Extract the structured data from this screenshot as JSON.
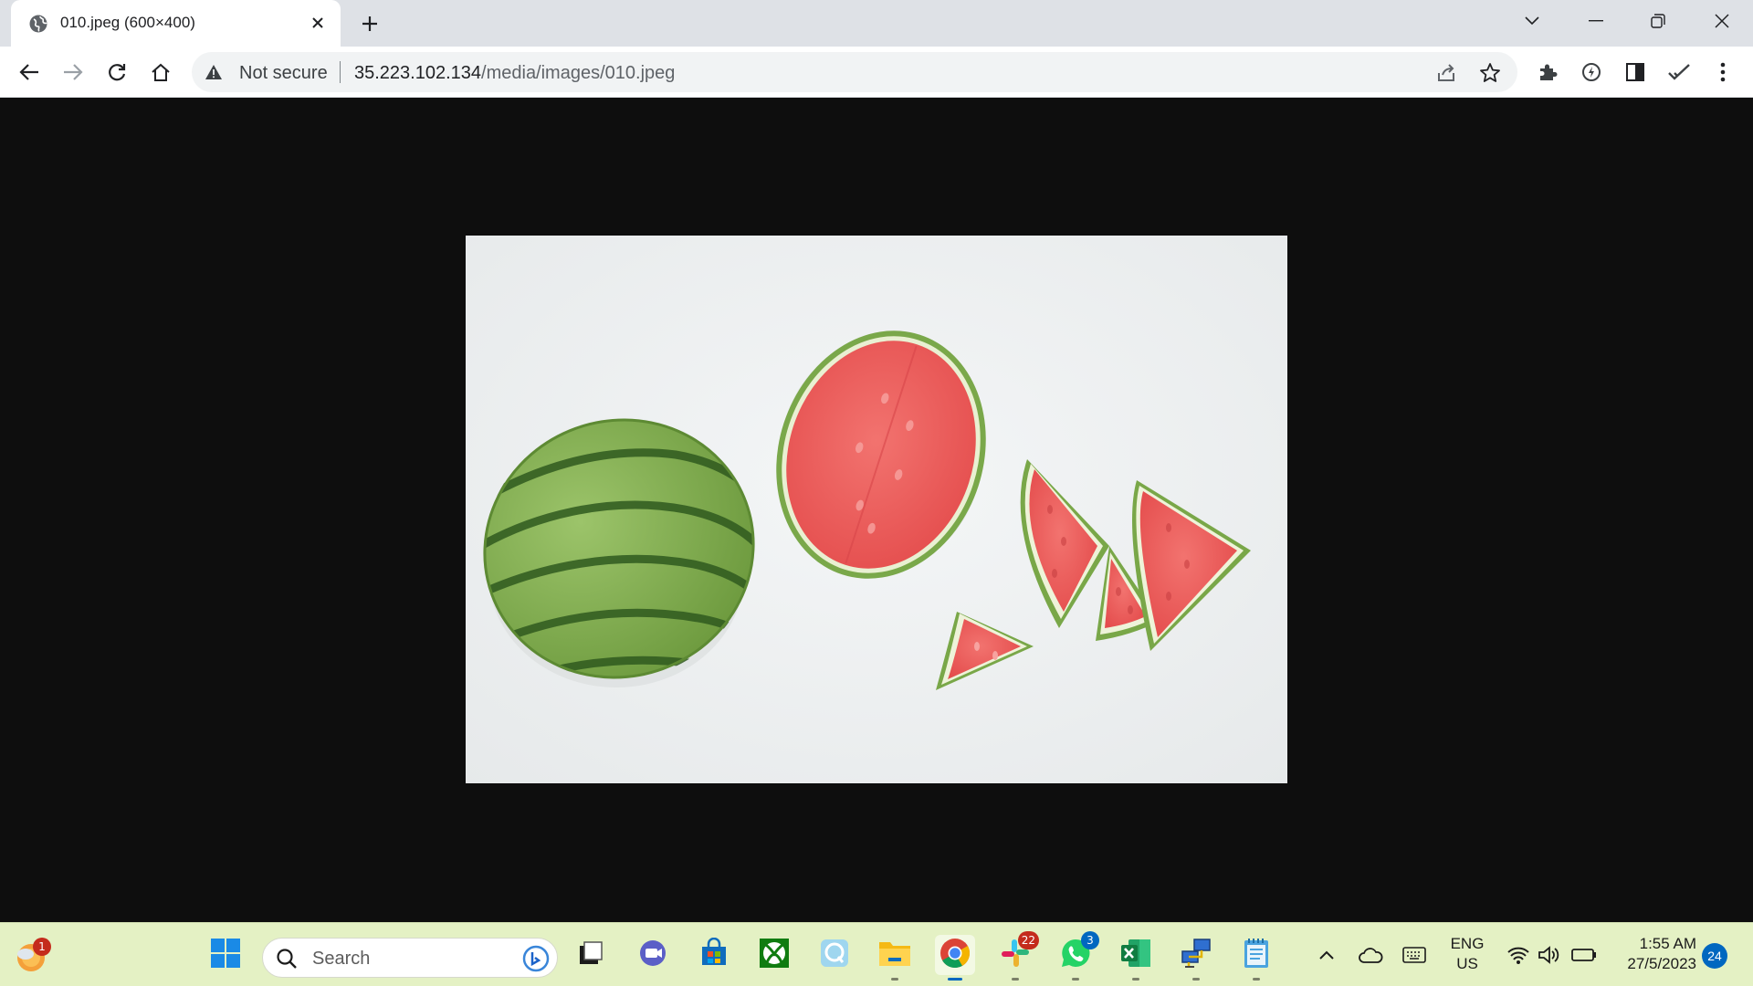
{
  "browser": {
    "tab": {
      "title": "010.jpeg (600×400)",
      "favicon": "globe-icon"
    },
    "new_tab_label": "+",
    "toolbar": {
      "security_label": "Not secure",
      "url_host": "35.223.102.134",
      "url_path": "/media/images/010.jpeg"
    }
  },
  "viewport": {
    "image": {
      "subject": "watermelon"
    }
  },
  "taskbar": {
    "weather_badge": "1",
    "search_placeholder": "Search",
    "apps": [
      {
        "name": "start",
        "icon": "windows-logo-icon"
      },
      {
        "name": "task-view",
        "icon": "task-view-icon"
      },
      {
        "name": "teams-chat",
        "icon": "camera-chat-icon"
      },
      {
        "name": "microsoft-store",
        "icon": "store-icon"
      },
      {
        "name": "xbox",
        "icon": "xbox-icon"
      },
      {
        "name": "app-q",
        "icon": "q-app-icon"
      },
      {
        "name": "file-explorer",
        "icon": "folder-icon"
      },
      {
        "name": "chrome",
        "icon": "chrome-icon"
      },
      {
        "name": "slack",
        "icon": "slack-icon",
        "badge": "22"
      },
      {
        "name": "whatsapp",
        "icon": "whatsapp-icon",
        "badge": "3"
      },
      {
        "name": "excel",
        "icon": "excel-icon"
      },
      {
        "name": "network-app",
        "icon": "network-computers-icon"
      },
      {
        "name": "notepad",
        "icon": "notepad-icon"
      }
    ],
    "tray": {
      "lang_line1": "ENG",
      "lang_line2": "US",
      "time": "1:55 AM",
      "date": "27/5/2023",
      "notification_count": "24"
    }
  },
  "colors": {
    "tabstrip": "#dee1e6",
    "viewport_bg": "#0e0e0e",
    "taskbar_bg": "#e4f1c4",
    "accent_blue": "#0067c0"
  }
}
